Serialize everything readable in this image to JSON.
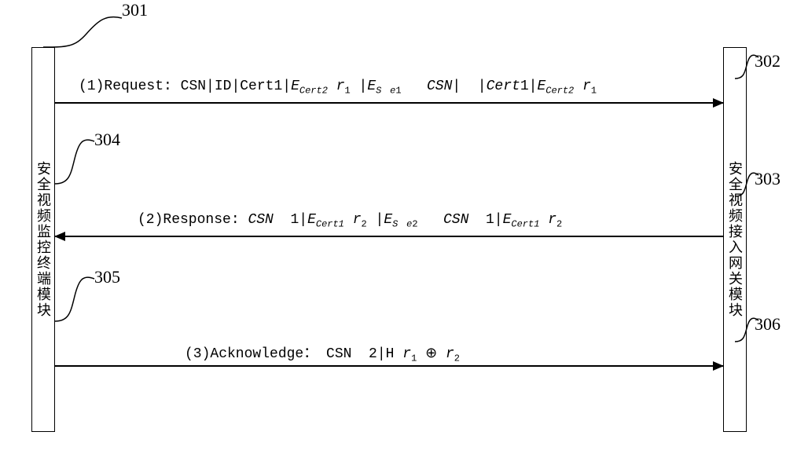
{
  "left_actor": {
    "title": "安全视频监控终端模块"
  },
  "right_actor": {
    "title": "安全视频接入网关模块"
  },
  "callouts": {
    "n301": "301",
    "n302": "302",
    "n303": "303",
    "n304": "304",
    "n305": "305",
    "n306": "306"
  },
  "messages": {
    "m1": {
      "prefix": "(1)Request:",
      "text_plain": "CSN|ID|Cert1|E_Cert2 r1 |E_S e1 CSN| |Cert1|E_Cert2 r1"
    },
    "m2": {
      "prefix": "(2)Response:",
      "text_plain": "CSN 1|E_Cert1 r2 |E_S e2 CSN 1|E_Cert1 r2"
    },
    "m3": {
      "prefix": "(3)Acknowledge：",
      "text_plain": "CSN 2|H r1 ⊕ r2"
    }
  }
}
